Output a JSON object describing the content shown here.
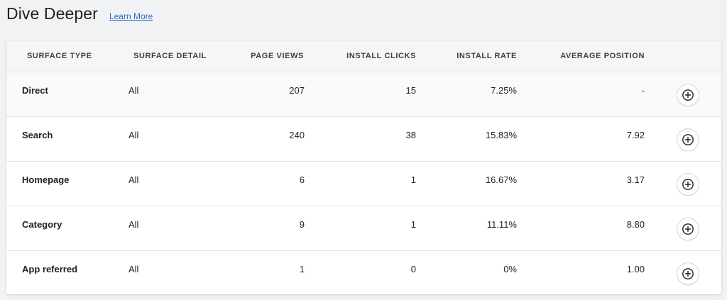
{
  "header": {
    "title": "Dive Deeper",
    "learn_more": "Learn More"
  },
  "table": {
    "columns": [
      "SURFACE TYPE",
      "SURFACE DETAIL",
      "PAGE VIEWS",
      "INSTALL CLICKS",
      "INSTALL RATE",
      "AVERAGE POSITION"
    ],
    "rows": [
      {
        "surface_type": "Direct",
        "surface_detail": "All",
        "page_views": "207",
        "install_clicks": "15",
        "install_rate": "7.25%",
        "average_position": "-"
      },
      {
        "surface_type": "Search",
        "surface_detail": "All",
        "page_views": "240",
        "install_clicks": "38",
        "install_rate": "15.83%",
        "average_position": "7.92"
      },
      {
        "surface_type": "Homepage",
        "surface_detail": "All",
        "page_views": "6",
        "install_clicks": "1",
        "install_rate": "16.67%",
        "average_position": "3.17"
      },
      {
        "surface_type": "Category",
        "surface_detail": "All",
        "page_views": "9",
        "install_clicks": "1",
        "install_rate": "11.11%",
        "average_position": "8.80"
      },
      {
        "surface_type": "App referred",
        "surface_detail": "All",
        "page_views": "1",
        "install_clicks": "0",
        "install_rate": "0%",
        "average_position": "1.00"
      }
    ],
    "row_action_icon": "circle-plus-icon"
  }
}
